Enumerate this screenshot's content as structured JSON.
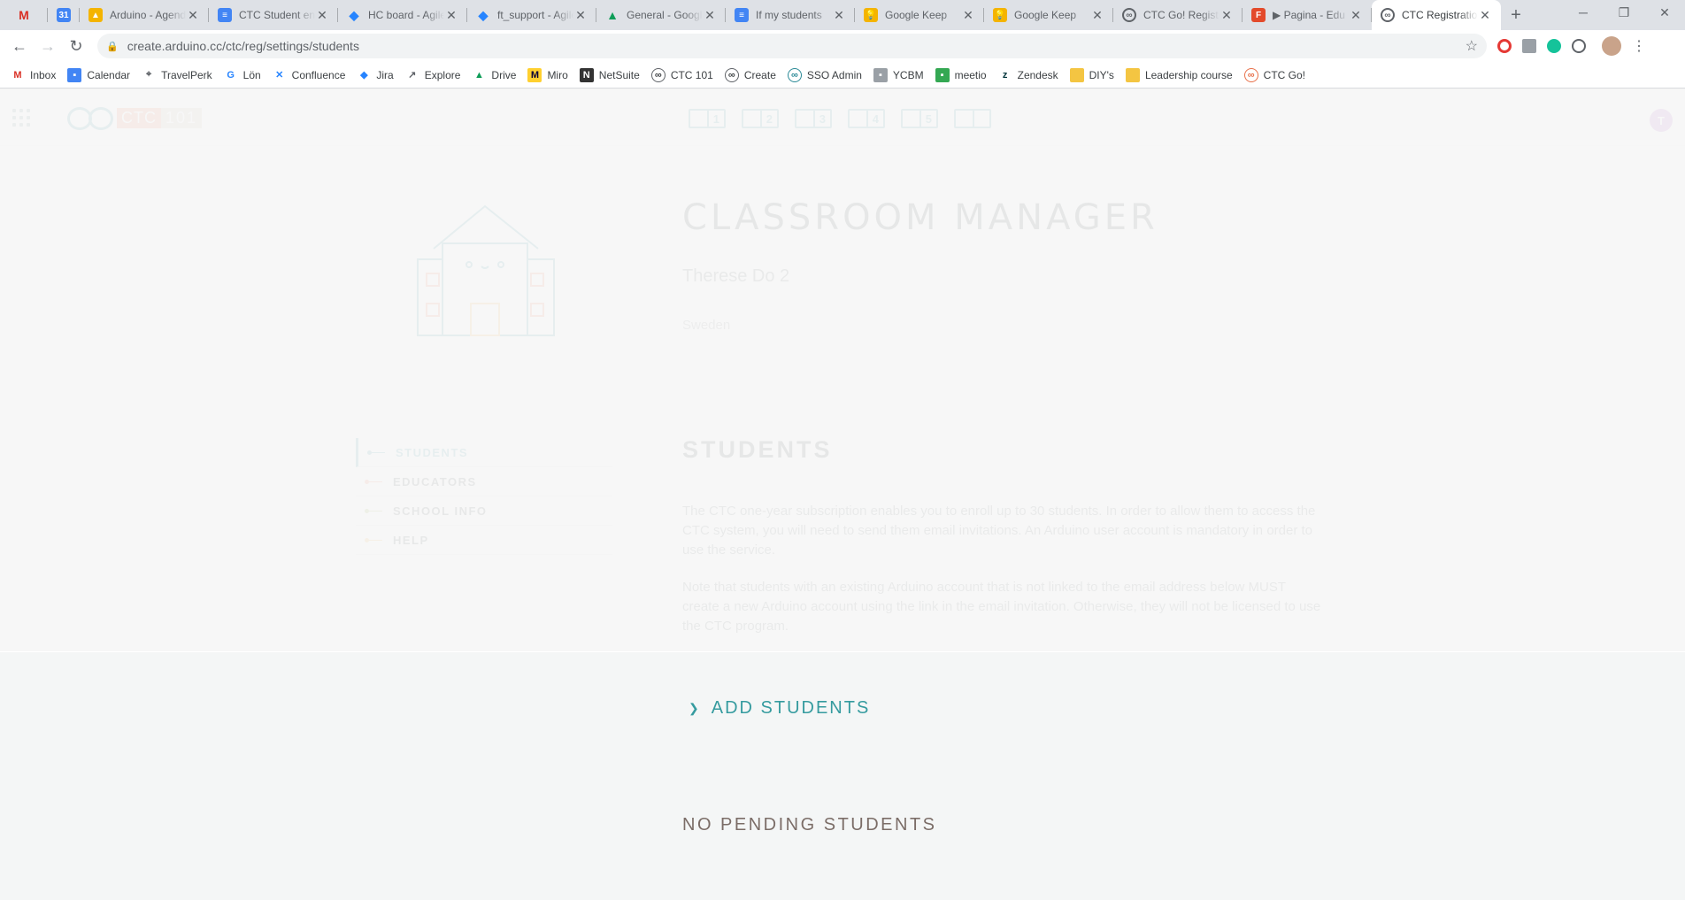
{
  "browser": {
    "tabs": [
      {
        "title": "",
        "icon": "gmail-icon",
        "color": "#d93025"
      },
      {
        "title": "",
        "icon": "calendar-icon",
        "color": "#4285f4"
      },
      {
        "title": "Arduino - Agenda",
        "icon": "drive-icon",
        "color": "#f4b400"
      },
      {
        "title": "CTC Student enrollment",
        "icon": "docs-icon",
        "color": "#4285f4"
      },
      {
        "title": "HC board - Agile",
        "icon": "jira-icon",
        "color": "#2684ff"
      },
      {
        "title": "ft_support - Agile",
        "icon": "jira-icon",
        "color": "#2684ff"
      },
      {
        "title": "General - Google Drive",
        "icon": "drive-icon",
        "color": "#0f9d58"
      },
      {
        "title": "If my students",
        "icon": "docs-icon",
        "color": "#4285f4"
      },
      {
        "title": "Google Keep",
        "icon": "keep-icon",
        "color": "#f4b400"
      },
      {
        "title": "Google Keep",
        "icon": "keep-icon",
        "color": "#f4b400"
      },
      {
        "title": "CTC Go! Registration",
        "icon": "arduino-icon",
        "color": "#5f6368"
      },
      {
        "title": "▶ Pagina - Edu",
        "icon": "figma-icon",
        "color": "#e34a2b"
      },
      {
        "title": "CTC Registration",
        "icon": "arduino-icon",
        "color": "#5f6368"
      }
    ],
    "url": "create.arduino.cc/ctc/reg/settings/students",
    "bookmarks": [
      "Inbox",
      "Calendar",
      "TravelPerk",
      "Lön",
      "Confluence",
      "Jira",
      "Explore",
      "Drive",
      "Miro",
      "NetSuite",
      "CTC 101",
      "Create",
      "SSO Admin",
      "YCBM",
      "meetio",
      "Zendesk",
      "DIY's",
      "Leadership course",
      "CTC Go!"
    ]
  },
  "header": {
    "logo_ctc": "CTC",
    "logo_num": "101",
    "books": [
      "1",
      "2",
      "3",
      "4",
      "5",
      ""
    ],
    "avatar_initial": "T"
  },
  "profile": {
    "title": "CLASSROOM MANAGER",
    "name": "Therese Do 2",
    "country": "Sweden"
  },
  "sidebar": {
    "items": [
      {
        "label": "STUDENTS",
        "color": "#2b8a97"
      },
      {
        "label": "EDUCATORS",
        "color": "#e8704a"
      },
      {
        "label": "SCHOOL INFO",
        "color": "#8aa33a"
      },
      {
        "label": "HELP",
        "color": "#f2a43a"
      }
    ]
  },
  "content": {
    "heading": "STUDENTS",
    "paragraph1": "The CTC one-year subscription enables you to enroll up to 30 students. In order to allow them to access the CTC system, you will need to send them email invitations. An Arduino user account is mandatory in order to use the service.",
    "paragraph2": "Note that students with an existing Arduino account that is not linked to the email address below MUST create a new Arduino account using the link in the email invitation. Otherwise, they will not be licensed to use the CTC program."
  },
  "lower": {
    "add_students": "ADD STUDENTS",
    "pending": "NO PENDING STUDENTS"
  }
}
